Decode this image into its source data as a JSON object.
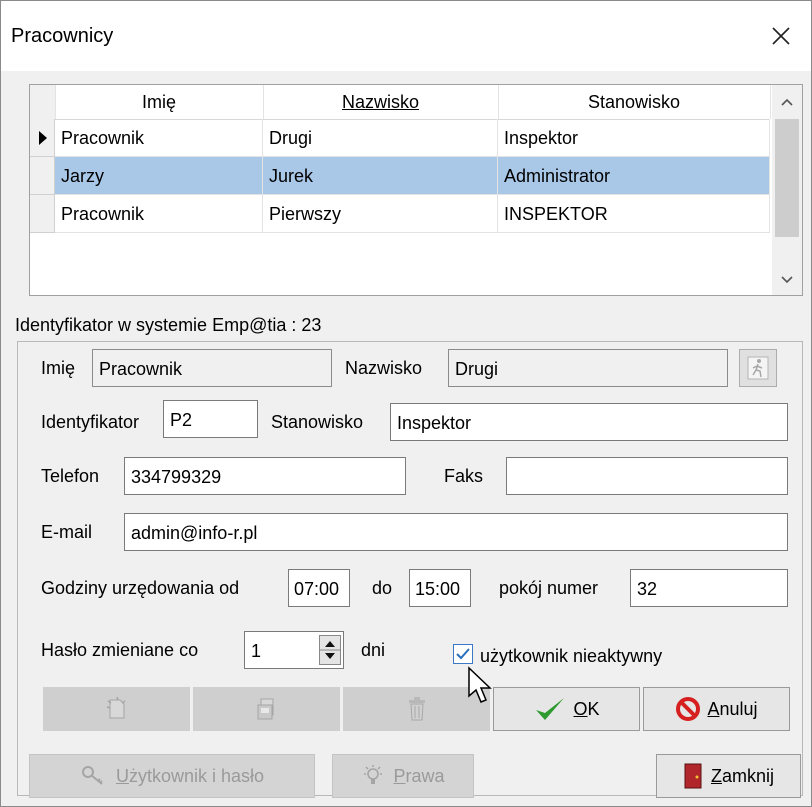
{
  "window": {
    "title": "Pracownicy"
  },
  "grid": {
    "headers": [
      "Imię",
      "Nazwisko",
      "Stanowisko"
    ],
    "rows": [
      {
        "first": "Pracownik",
        "last": "Drugi",
        "position": "Inspektor",
        "current": true,
        "selected": false
      },
      {
        "first": "Jarzy",
        "last": "Jurek",
        "position": "Administrator",
        "current": false,
        "selected": true
      },
      {
        "first": "Pracownik",
        "last": "Pierwszy",
        "position": "INSPEKTOR",
        "current": false,
        "selected": false
      }
    ]
  },
  "system_id_label": "Identyfikator w systemie Emp@tia : 23",
  "form": {
    "first_name_label": "Imię",
    "first_name_value": "Pracownik",
    "last_name_label": "Nazwisko",
    "last_name_value": "Drugi",
    "identifier_label": "Identyfikator",
    "identifier_value": "P2",
    "position_label": "Stanowisko",
    "position_value": "Inspektor",
    "phone_label": "Telefon",
    "phone_value": "334799329",
    "fax_label": "Faks",
    "fax_value": "",
    "email_label": "E-mail",
    "email_value": "admin@info-r.pl",
    "hours_label": "Godziny urzędowania od",
    "hours_from": "07:00",
    "hours_to_label": "do",
    "hours_to": "15:00",
    "room_label": "pokój numer",
    "room_value": "32",
    "password_label": "Hasło zmieniane co",
    "password_value": "1",
    "password_unit": "dni",
    "inactive_label": "użytkownik nieaktywny",
    "inactive_checked": true
  },
  "buttons": {
    "ok": "OK",
    "ok_accel": "O",
    "ok_rest": "K",
    "cancel_accel": "A",
    "cancel_rest": "nuluj",
    "user_accel": "U",
    "user_rest": "żytkownik i hasło",
    "rights_accel": "P",
    "rights_rest": "rawa",
    "close_accel": "Z",
    "close_rest": "amknij"
  },
  "colors": {
    "selection": "#a9c8e8",
    "ok_check": "#2e9b2e",
    "cancel_red": "#d62020",
    "door": "#b0262b"
  }
}
